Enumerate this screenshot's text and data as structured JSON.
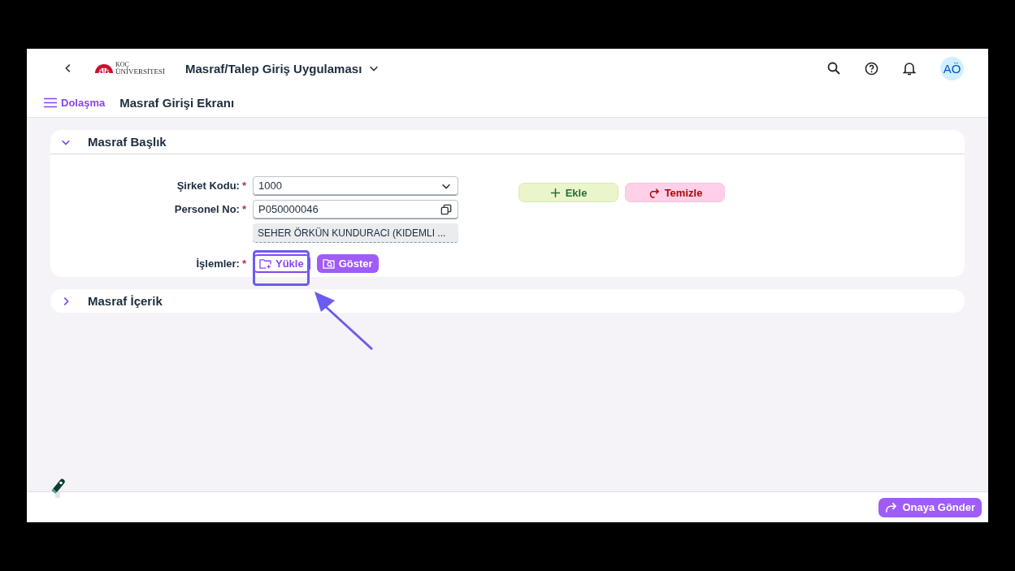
{
  "shell_bar": {
    "logo_lines": [
      "KOÇ",
      "ÜNİVERSİTESİ"
    ],
    "app_title": "Masraf/Talep Giriş Uygulaması",
    "avatar": "AÖ"
  },
  "sub_header": {
    "nav_label": "Dolaşma",
    "page_title": "Masraf Girişi Ekranı"
  },
  "panels": [
    {
      "title": "Masraf Başlık",
      "expanded": true,
      "fields": [
        {
          "kind": "select",
          "label": "Şirket Kodu:",
          "mark": "*",
          "value": "1000"
        },
        {
          "kind": "input",
          "label": "Personel No:",
          "mark": "*",
          "value": "P050000046"
        },
        {
          "kind": "display",
          "value": "SEHER ÖRKÜN KUNDURACI (KIDEMLI ..."
        },
        {
          "kind": "actions",
          "label": "İşlemler:",
          "mark": "*",
          "buttons": [
            {
              "label": "Yükle",
              "kind": "outline"
            },
            {
              "label": "Göster",
              "kind": "filled"
            }
          ]
        }
      ],
      "buttons": [
        {
          "label": "Ekle",
          "kind": "add"
        },
        {
          "label": "Temizle",
          "kind": "clear"
        }
      ]
    },
    {
      "title": "Masraf İçerik",
      "expanded": false
    }
  ],
  "footer": {
    "submit": "Onaya Gönder"
  }
}
